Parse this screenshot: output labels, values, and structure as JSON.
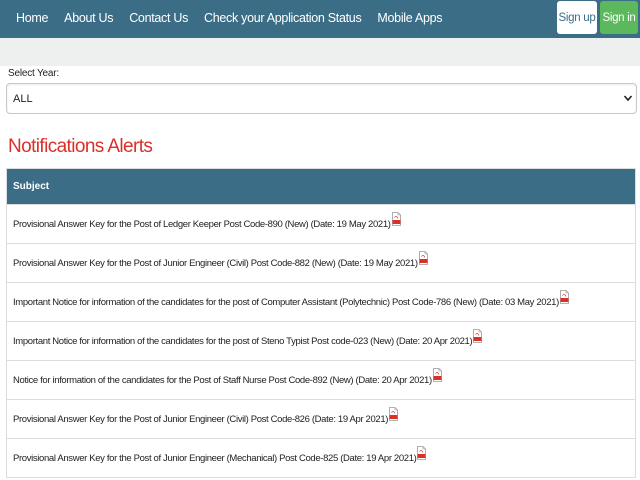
{
  "nav": {
    "links": [
      "Home",
      "About Us",
      "Contact Us",
      "Check your Application Status",
      "Mobile Apps"
    ],
    "signup_label": "Sign up",
    "signin_label": "Sign in"
  },
  "filter": {
    "label": "Select Year:",
    "selected": "ALL"
  },
  "notifications": {
    "title": "Notifications Alerts",
    "column_header": "Subject",
    "rows": [
      "Provisional Answer Key for the Post of Ledger Keeper Post Code-890 (New) (Date: 19 May 2021)",
      "Provisional Answer Key for the Post of Junior Engineer (Civil) Post Code-882 (New) (Date: 19 May 2021)",
      "Important Notice for information of the candidates for the post of Computer Assistant (Polytechnic) Post Code-786 (New) (Date: 03 May 2021)",
      "Important Notice for information of the candidates for the post of Steno Typist Post code-023 (New) (Date: 20 Apr 2021)",
      "Notice for information of the candidates for the Post of Staff Nurse Post Code-892 (New) (Date: 20 Apr 2021)",
      "Provisional Answer Key for the Post of Junior Engineer (Civil) Post Code-826 (Date: 19 Apr 2021)",
      "Provisional Answer Key for the Post of Junior Engineer (Mechanical) Post Code-825 (Date: 19 Apr 2021)"
    ]
  },
  "colors": {
    "navbar": "#3b6e86",
    "signin": "#5cb85c",
    "title": "#d9302a"
  },
  "icons": {
    "row_icon": "pdf-icon",
    "select_icon": "chevron-down-icon"
  }
}
